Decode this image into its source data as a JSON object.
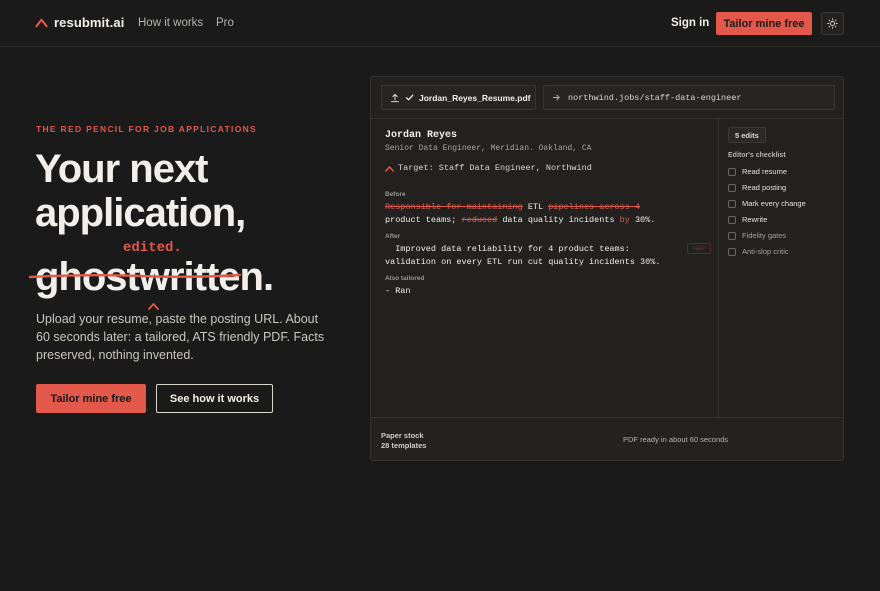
{
  "nav": {
    "brand": "resubmit.ai",
    "links": [
      "How it works",
      "Pro"
    ],
    "signin": "Sign in",
    "cta": "Tailor mine free"
  },
  "hero": {
    "eyebrow": "THE RED PENCIL FOR JOB APPLICATIONS",
    "line1": "Your next",
    "line2": "application,",
    "ghost_word": "ghostwritten",
    "ghost_period": ".",
    "edited_word": "edited.",
    "subtitle": "Upload your resume, paste the posting URL. About 60 seconds later: a tailored, ATS friendly PDF. Facts preserved, nothing invented.",
    "primary_cta": "Tailor mine free",
    "secondary_cta": "See how it works"
  },
  "editor": {
    "file_name": "Jordan_Reyes_Resume.pdf",
    "posting_url": "northwind.jobs/staff-data-engineer",
    "resume_name": "Jordan Reyes",
    "resume_role": "Senior Data Engineer, Meridian. Oakland, CA",
    "target": "Target: Staff Data Engineer, Northwind",
    "before_label": "Before",
    "before_line1": {
      "a": "Responsible for maintaining",
      "b": " ETL ",
      "c": "pipelines across 4",
      "d": ""
    },
    "before_line2": {
      "a": "product teams; ",
      "b": "reduced",
      "c": " data quality incidents ",
      "d": "by",
      "e": " 30%."
    },
    "after_label": "After",
    "after_line1": "  Improved data reliability for 4 product teams:",
    "after_line2": "validation on every ETL run cut quality incidents 30%.",
    "stamp": "KEEP",
    "also_label": "Also tailored",
    "also_line": "- Ran"
  },
  "checklist": {
    "edits_badge": "5 edits",
    "title": "Editor's checklist",
    "items": [
      {
        "label": "Read resume",
        "done": true
      },
      {
        "label": "Read posting",
        "done": true
      },
      {
        "label": "Mark every change",
        "done": true
      },
      {
        "label": "Rewrite",
        "done": true
      },
      {
        "label": "Fidelity gates",
        "done": false
      },
      {
        "label": "Anti-slop critic",
        "done": false
      }
    ]
  },
  "footer": {
    "paper_label": "Paper stock",
    "paper_count": "28 templates",
    "ready": "PDF ready in about 60 seconds"
  },
  "colors": {
    "accent": "#e2584a",
    "background": "#1b1a1a",
    "panel": "#222120"
  },
  "icons": [
    "logo-caret-icon",
    "sun-icon",
    "upload-icon",
    "check-icon",
    "arrow-right-icon",
    "caret-up-icon"
  ]
}
